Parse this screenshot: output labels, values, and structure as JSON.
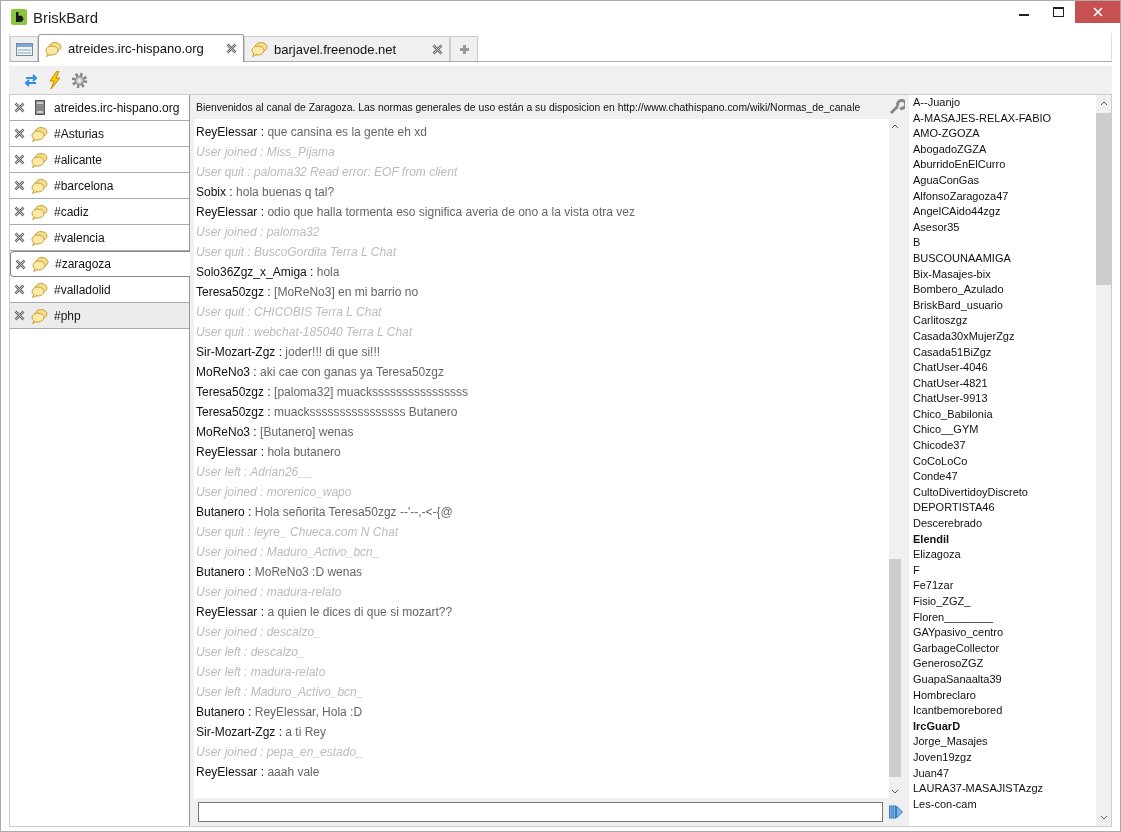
{
  "window": {
    "title": "BriskBard"
  },
  "tabs": [
    {
      "label": "atreides.irc-hispano.org",
      "selected": true
    },
    {
      "label": "barjavel.freenode.net",
      "selected": false
    }
  ],
  "sidebar": {
    "items": [
      {
        "kind": "server",
        "label": "atreides.irc-hispano.org",
        "selected": false,
        "hovered": false
      },
      {
        "kind": "channel",
        "label": "#Asturias",
        "selected": false,
        "hovered": false
      },
      {
        "kind": "channel",
        "label": "#alicante",
        "selected": false,
        "hovered": false
      },
      {
        "kind": "channel",
        "label": "#barcelona",
        "selected": false,
        "hovered": false
      },
      {
        "kind": "channel",
        "label": "#cadiz",
        "selected": false,
        "hovered": false
      },
      {
        "kind": "channel",
        "label": "#valencia",
        "selected": false,
        "hovered": false
      },
      {
        "kind": "channel",
        "label": "#zaragoza",
        "selected": true,
        "hovered": false
      },
      {
        "kind": "channel",
        "label": "#valladolid",
        "selected": false,
        "hovered": false
      },
      {
        "kind": "channel",
        "label": "#php",
        "selected": false,
        "hovered": true
      }
    ]
  },
  "chat": {
    "topic": "Bienvenidos al canal de Zaragoza. Las normas generales de uso están a su disposicion en http://www.chathispano.com/wiki/Normas_de_canale",
    "lines": [
      {
        "kind": "message",
        "nick": "ReyElessar :",
        "text": "que cansina es la gente eh xd"
      },
      {
        "kind": "event",
        "text": "User joined : Miss_Pijama"
      },
      {
        "kind": "event",
        "text": "User quit : paloma32 Read error: EOF from client"
      },
      {
        "kind": "message",
        "nick": "Sobix :",
        "text": "hola buenas q tal?"
      },
      {
        "kind": "message",
        "nick": "ReyElessar :",
        "text": "odio que halla tormenta eso significa averia de ono a la vista otra vez"
      },
      {
        "kind": "event",
        "text": "User joined : paloma32"
      },
      {
        "kind": "event",
        "text": "User quit : BuscoGordita Terra L Chat"
      },
      {
        "kind": "message",
        "nick": "Solo36Zgz_x_Amiga :",
        "text": "hola"
      },
      {
        "kind": "message",
        "nick": "Teresa50zgz :",
        "text": "[MoReNo3] en mi barrio no"
      },
      {
        "kind": "event",
        "text": "User quit : CHICOBIS Terra L Chat"
      },
      {
        "kind": "event",
        "text": "User quit : webchat-185040 Terra L Chat"
      },
      {
        "kind": "message",
        "nick": "Sir-Mozart-Zgz :",
        "text": "joder!!! di que si!!!"
      },
      {
        "kind": "message",
        "nick": "MoReNo3 :",
        "text": "aki cae con ganas ya Teresa50zgz"
      },
      {
        "kind": "message",
        "nick": "Teresa50zgz :",
        "text": "[paloma32] muackssssssssssssssss"
      },
      {
        "kind": "message",
        "nick": "Teresa50zgz :",
        "text": "muackssssssssssssssss Butanero"
      },
      {
        "kind": "message",
        "nick": "MoReNo3 :",
        "text": "[Butanero] wenas"
      },
      {
        "kind": "message",
        "nick": "ReyElessar :",
        "text": "hola butanero"
      },
      {
        "kind": "event",
        "text": "User left : Adrian26__"
      },
      {
        "kind": "event",
        "text": "User joined : morenico_wapo"
      },
      {
        "kind": "message",
        "nick": "Butanero :",
        "text": "Hola señorita Teresa50zgz --'--,-<-{@"
      },
      {
        "kind": "event",
        "text": "User quit : leyre_ Chueca.com N Chat"
      },
      {
        "kind": "event",
        "text": "User joined : Maduro_Activo_bcn_"
      },
      {
        "kind": "message",
        "nick": "Butanero :",
        "text": "MoReNo3 :D wenas"
      },
      {
        "kind": "event",
        "text": "User joined : madura-relato"
      },
      {
        "kind": "message",
        "nick": "ReyElessar :",
        "text": "a quien le dices di que si mozart??"
      },
      {
        "kind": "event",
        "text": "User joined : descalzo_"
      },
      {
        "kind": "event",
        "text": "User left : descalzo_"
      },
      {
        "kind": "event",
        "text": "User left : madura-relato"
      },
      {
        "kind": "event",
        "text": "User left : Maduro_Activo_bcn_"
      },
      {
        "kind": "message",
        "nick": "Butanero :",
        "text": "ReyElessar, Hola :D"
      },
      {
        "kind": "message",
        "nick": "Sir-Mozart-Zgz :",
        "text": "a ti Rey"
      },
      {
        "kind": "event",
        "text": "User joined : pepa_en_estado_"
      },
      {
        "kind": "message",
        "nick": "ReyElessar :",
        "text": "aaah vale"
      }
    ]
  },
  "users": [
    {
      "name": "A--Juanjo",
      "operator": false
    },
    {
      "name": "A-MASAJES-RELAX-FABIO",
      "operator": false
    },
    {
      "name": "AMO-ZGOZA",
      "operator": false
    },
    {
      "name": "AbogadoZGZA",
      "operator": false
    },
    {
      "name": "AburridoEnElCurro",
      "operator": false
    },
    {
      "name": "AguaConGas",
      "operator": false
    },
    {
      "name": "AlfonsoZaragoza47",
      "operator": false
    },
    {
      "name": "AngelCAido44zgz",
      "operator": false
    },
    {
      "name": "Asesor35",
      "operator": false
    },
    {
      "name": "B",
      "operator": false
    },
    {
      "name": "BUSCOUNAAMIGA",
      "operator": false
    },
    {
      "name": "Bix-Masajes-bix",
      "operator": false
    },
    {
      "name": "Bombero_Azulado",
      "operator": false
    },
    {
      "name": "BriskBard_usuario",
      "operator": false
    },
    {
      "name": "Carlitoszgz",
      "operator": false
    },
    {
      "name": "Casada30xMujerZgz",
      "operator": false
    },
    {
      "name": "Casada51BiZgz",
      "operator": false
    },
    {
      "name": "ChatUser-4046",
      "operator": false
    },
    {
      "name": "ChatUser-4821",
      "operator": false
    },
    {
      "name": "ChatUser-9913",
      "operator": false
    },
    {
      "name": "Chico_Babilonia",
      "operator": false
    },
    {
      "name": "Chico__GYM",
      "operator": false
    },
    {
      "name": "Chicode37",
      "operator": false
    },
    {
      "name": "CoCoLoCo",
      "operator": false
    },
    {
      "name": "Conde47",
      "operator": false
    },
    {
      "name": "CultoDivertidoyDiscreto",
      "operator": false
    },
    {
      "name": "DEPORTISTA46",
      "operator": false
    },
    {
      "name": "Descerebrado",
      "operator": false
    },
    {
      "name": "Elendil",
      "operator": true
    },
    {
      "name": "Elizagoza",
      "operator": false
    },
    {
      "name": "F",
      "operator": false
    },
    {
      "name": "Fe71zar",
      "operator": false
    },
    {
      "name": "Fisio_ZGZ_",
      "operator": false
    },
    {
      "name": "Floren________",
      "operator": false
    },
    {
      "name": "GAYpasivo_centro",
      "operator": false
    },
    {
      "name": "GarbageCollector",
      "operator": false
    },
    {
      "name": "GenerosoZGZ",
      "operator": false
    },
    {
      "name": "GuapaSanaalta39",
      "operator": false
    },
    {
      "name": "Hombreclaro",
      "operator": false
    },
    {
      "name": "Icantbemorebored",
      "operator": false
    },
    {
      "name": "IrcGuarD",
      "operator": true
    },
    {
      "name": "Jorge_Masajes",
      "operator": false
    },
    {
      "name": "Joven19zgz",
      "operator": false
    },
    {
      "name": "Juan47",
      "operator": false
    },
    {
      "name": "LAURA37-MASAJISTAzgz",
      "operator": false
    },
    {
      "name": "Les-con-cam",
      "operator": false
    }
  ]
}
